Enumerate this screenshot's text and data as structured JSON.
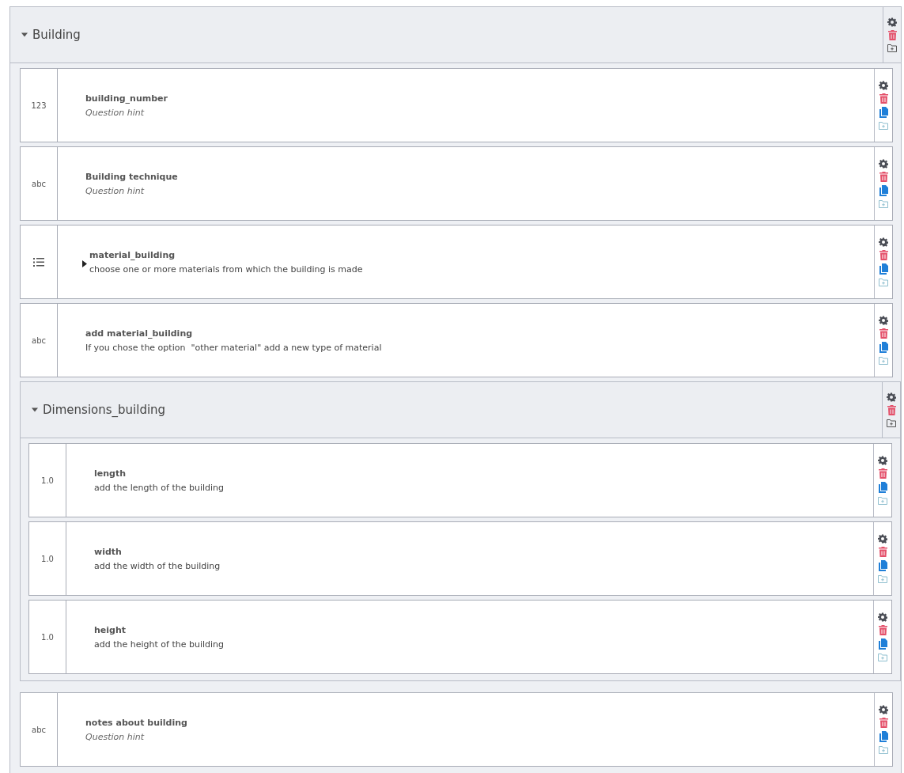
{
  "group": {
    "title": "Building",
    "expanded": true,
    "items": [
      {
        "kind": "question",
        "type_label": "123",
        "name": "building_number",
        "hint": "Question hint",
        "hint_placeholder": true
      },
      {
        "kind": "question",
        "type_label": "abc",
        "name": "Building technique",
        "hint": "Question hint",
        "hint_placeholder": true
      },
      {
        "kind": "select",
        "name": "material_building",
        "hint": "choose one or more materials from which the building is made",
        "hint_placeholder": false
      },
      {
        "kind": "question",
        "type_label": "abc",
        "name": "add material_building",
        "hint": "If you chose the option  \"other material\" add a new type of material",
        "hint_placeholder": false
      },
      {
        "kind": "group",
        "title": "Dimensions_building",
        "expanded": true,
        "items": [
          {
            "kind": "question",
            "type_label": "1.0",
            "name": "length",
            "hint": "add the length of the building",
            "hint_placeholder": false
          },
          {
            "kind": "question",
            "type_label": "1.0",
            "name": "width",
            "hint": "add the width of the building",
            "hint_placeholder": false
          },
          {
            "kind": "question",
            "type_label": "1.0",
            "name": "height",
            "hint": "add the height of the building",
            "hint_placeholder": false
          }
        ]
      },
      {
        "kind": "question",
        "type_label": "abc",
        "name": "notes about building",
        "hint": "Question hint",
        "hint_placeholder": true
      }
    ]
  }
}
